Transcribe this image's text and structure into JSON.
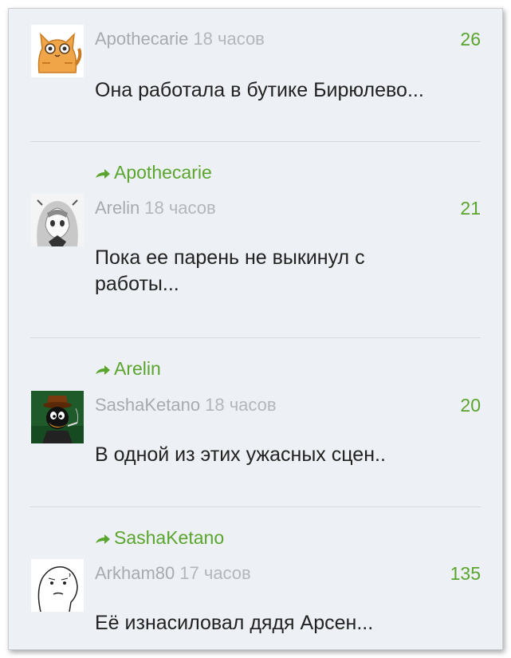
{
  "comments": [
    {
      "reply_to": "",
      "author": "Apothecarie",
      "time": "18 часов",
      "score": "26",
      "text": "Она работала в бутике Бирюлево...",
      "avatar": "cat-avatar-icon"
    },
    {
      "reply_to": "Apothecarie",
      "author": "Arelin",
      "time": "18 часов",
      "score": "21",
      "text": "Пока ее парень не выкинул с работы...",
      "avatar": "anime-girl-avatar-icon"
    },
    {
      "reply_to": "Arelin",
      "author": "SashaKetano",
      "time": "18 часов",
      "score": "20",
      "text": "В одной из этих ужасных сцен..",
      "avatar": "cartoon-duck-avatar-icon"
    },
    {
      "reply_to": "SashaKetano",
      "author": "Arkham80",
      "time": "17 часов",
      "score": "135",
      "text": "Её изнасиловал дядя Арсен...",
      "avatar": "rage-face-avatar-icon"
    }
  ],
  "colors": {
    "accent": "#5aa52e",
    "background": "#edf0f4",
    "author": "#a7abb0",
    "text": "#222222"
  }
}
